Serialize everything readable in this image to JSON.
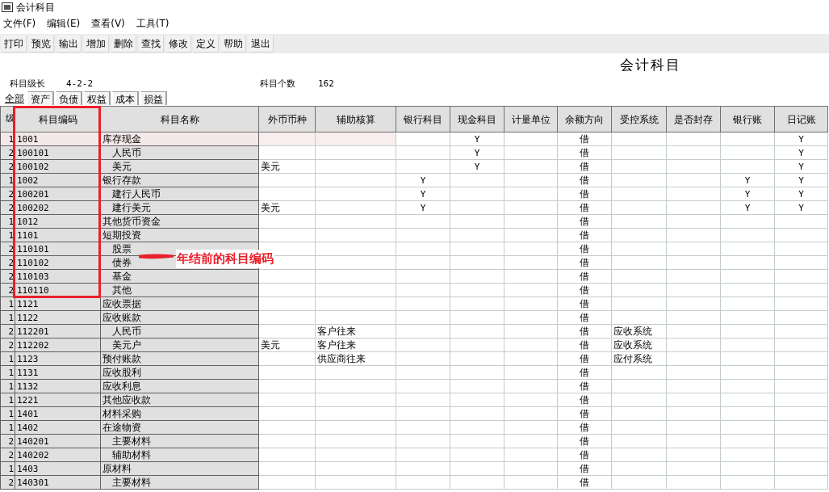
{
  "window": {
    "title": "会计科目"
  },
  "menu": [
    "文件(F)",
    "编辑(E)",
    "查看(V)",
    "工具(T)"
  ],
  "toolbar": [
    "打印",
    "预览",
    "输出",
    "增加",
    "删除",
    "查找",
    "修改",
    "定义",
    "帮助",
    "退出"
  ],
  "heading": "会计科目",
  "info": {
    "level_label": "科目级长",
    "level_value": "4-2-2",
    "count_label": "科目个数",
    "count_value": "162"
  },
  "tabs": [
    {
      "label": "全部",
      "selected": true
    },
    {
      "label": "资产",
      "selected": false
    },
    {
      "label": "负债",
      "selected": false
    },
    {
      "label": "权益",
      "selected": false
    },
    {
      "label": "成本",
      "selected": false
    },
    {
      "label": "损益",
      "selected": false
    }
  ],
  "table": {
    "columns": [
      "级",
      "科目编码",
      "科目名称",
      "外币币种",
      "辅助核算",
      "银行科目",
      "现金科目",
      "计量单位",
      "余额方向",
      "受控系统",
      "是否封存",
      "银行账",
      "日记账"
    ],
    "rows": [
      {
        "grade": "1",
        "code": "1001",
        "name": "库存现金",
        "cash": "Y",
        "direction": "借",
        "journal": "Y",
        "selected": true,
        "children": [
          {
            "grade": "2",
            "code": "100101",
            "name": "人民币",
            "cash": "Y",
            "direction": "借",
            "journal": "Y",
            "selected": false
          },
          {
            "grade": "2",
            "code": "100102",
            "name": "美元",
            "currency": "美元",
            "cash": "Y",
            "direction": "借",
            "journal": "Y",
            "selected": false
          }
        ]
      },
      {
        "grade": "1",
        "code": "1002",
        "name": "银行存款",
        "bank": "Y",
        "direction": "借",
        "bankbook": "Y",
        "journal": "Y",
        "selected": false,
        "children": [
          {
            "grade": "2",
            "code": "100201",
            "name": "建行人民币",
            "bank": "Y",
            "direction": "借",
            "bankbook": "Y",
            "journal": "Y",
            "selected": false
          },
          {
            "grade": "2",
            "code": "100202",
            "name": "建行美元",
            "currency": "美元",
            "bank": "Y",
            "direction": "借",
            "bankbook": "Y",
            "journal": "Y",
            "selected": false
          }
        ]
      },
      {
        "grade": "1",
        "code": "1012",
        "name": "其他货币资金",
        "direction": "借",
        "selected": false
      },
      {
        "grade": "1",
        "code": "1101",
        "name": "短期投资",
        "direction": "借",
        "selected": false,
        "children": [
          {
            "grade": "2",
            "code": "110101",
            "name": "股票",
            "direction": "借",
            "selected": false
          },
          {
            "grade": "2",
            "code": "110102",
            "name": "债券",
            "direction": "借",
            "selected": false
          },
          {
            "grade": "2",
            "code": "110103",
            "name": "基金",
            "direction": "借",
            "selected": false
          },
          {
            "grade": "2",
            "code": "110110",
            "name": "其他",
            "direction": "借",
            "selected": false
          }
        ]
      },
      {
        "grade": "1",
        "code": "1121",
        "name": "应收票据",
        "direction": "借",
        "selected": false
      },
      {
        "grade": "1",
        "code": "1122",
        "name": "应收账款",
        "direction": "借",
        "selected": false,
        "children": [
          {
            "grade": "2",
            "code": "112201",
            "name": "人民币",
            "aux": "客户往来",
            "direction": "借",
            "controlled": "应收系统",
            "selected": false
          },
          {
            "grade": "2",
            "code": "112202",
            "name": "美元户",
            "currency": "美元",
            "aux": "客户往来",
            "direction": "借",
            "controlled": "应收系统",
            "selected": false
          }
        ]
      },
      {
        "grade": "1",
        "code": "1123",
        "name": "预付账款",
        "aux": "供应商往来",
        "direction": "借",
        "controlled": "应付系统",
        "selected": false
      },
      {
        "grade": "1",
        "code": "1131",
        "name": "应收股利",
        "direction": "借",
        "selected": false
      },
      {
        "grade": "1",
        "code": "1132",
        "name": "应收利息",
        "direction": "借",
        "selected": false
      },
      {
        "grade": "1",
        "code": "1221",
        "name": "其他应收款",
        "direction": "借",
        "selected": false
      },
      {
        "grade": "1",
        "code": "1401",
        "name": "材料采购",
        "direction": "借",
        "selected": false
      },
      {
        "grade": "1",
        "code": "1402",
        "name": "在途物资",
        "direction": "借",
        "selected": false,
        "children": [
          {
            "grade": "2",
            "code": "140201",
            "name": "主要材料",
            "direction": "借",
            "selected": false
          },
          {
            "grade": "2",
            "code": "140202",
            "name": "辅助材料",
            "direction": "借",
            "selected": false
          }
        ]
      },
      {
        "grade": "1",
        "code": "1403",
        "name": "原材料",
        "direction": "借",
        "selected": false,
        "children": [
          {
            "grade": "2",
            "code": "140301",
            "name": "主要材料",
            "direction": "借",
            "selected": false
          }
        ]
      }
    ]
  },
  "annotation": {
    "text": "年结前的科目编码"
  }
}
